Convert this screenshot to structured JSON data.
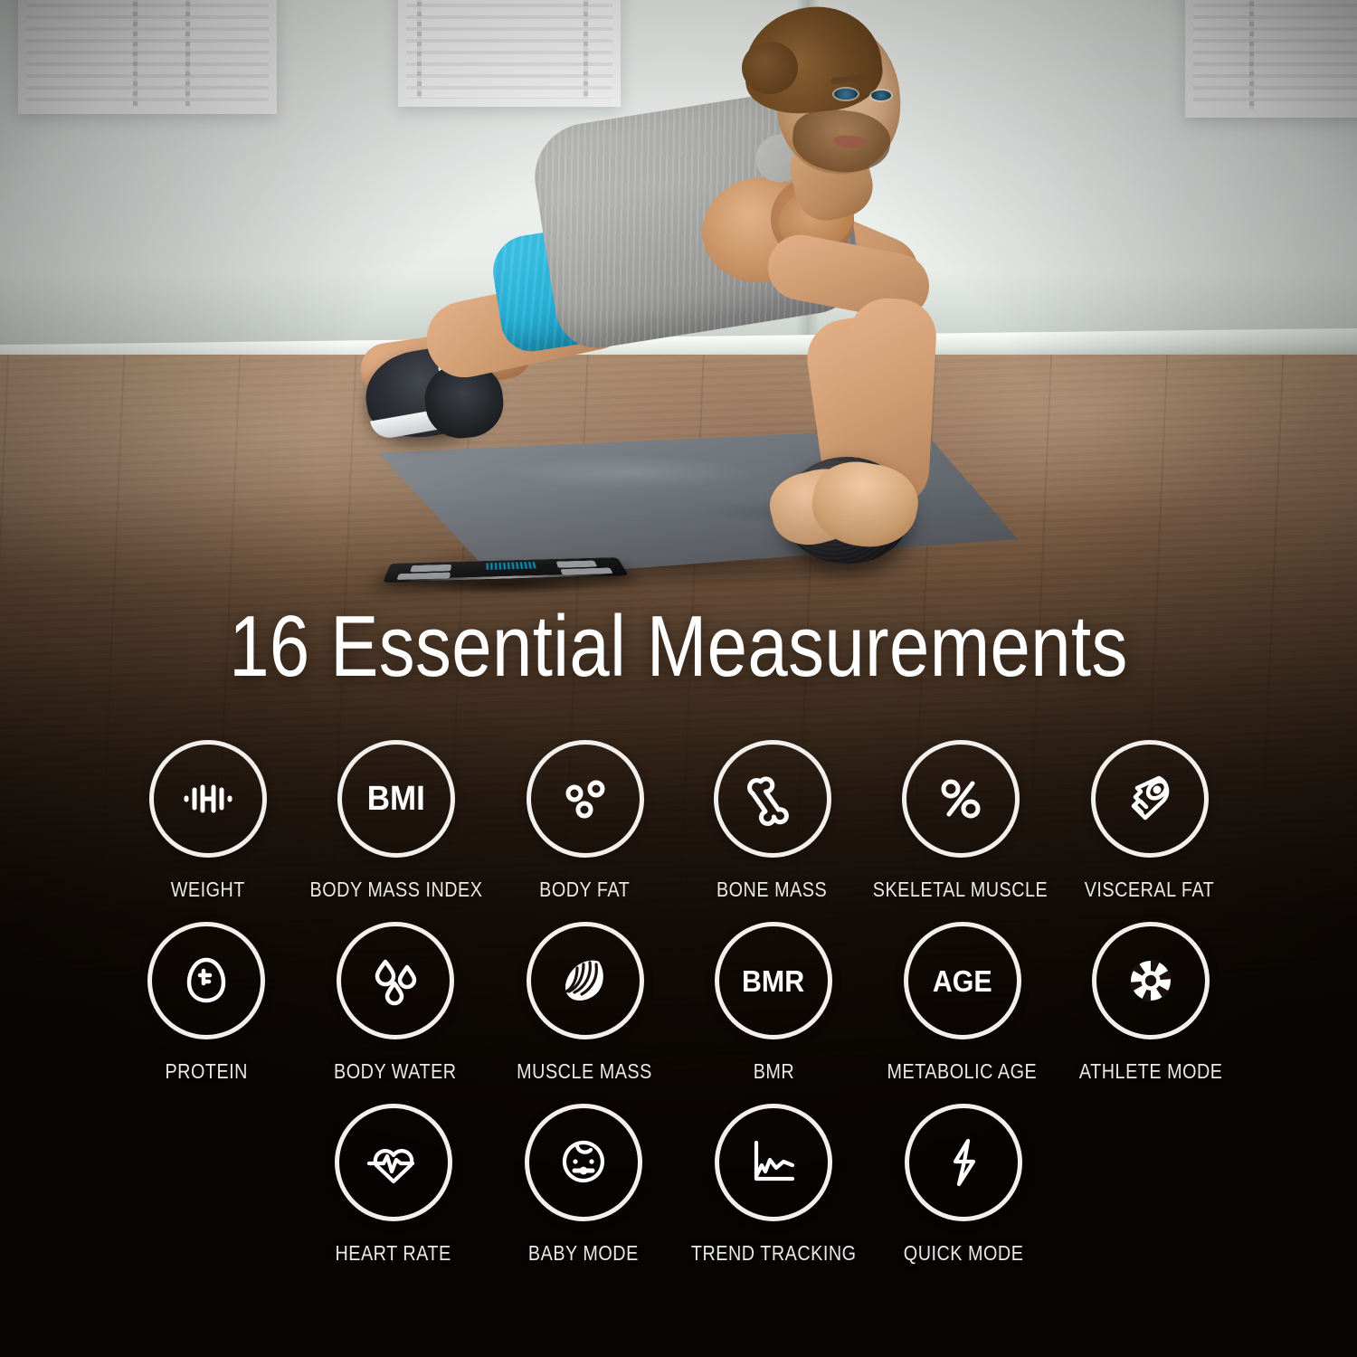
{
  "headline": "16 Essential Measurements",
  "colors": {
    "ring_stroke": "#f2efec",
    "label_text": "#eceae7",
    "headline_text": "#ffffff",
    "backdrop_dark": "#140d08",
    "shorts_cyan": "#29b6dc",
    "tank_gray": "#b4b4b2",
    "scale_display_blue": "#1bb9e6"
  },
  "scene": {
    "subject": "man-doing-plank-pushup",
    "props": [
      "yoga-mat",
      "medicine-ball",
      "smart-body-fat-scale"
    ],
    "setting": "bright-room-wood-floor"
  },
  "rows": [
    {
      "items": [
        {
          "label": "WEIGHT",
          "icon": "dumbbell-icon"
        },
        {
          "label": "BODY MASS INDEX",
          "icon": "bmi-text-icon",
          "icon_text": "BMI"
        },
        {
          "label": "BODY FAT",
          "icon": "fat-cells-icon"
        },
        {
          "label": "BONE MASS",
          "icon": "bone-icon"
        },
        {
          "label": "SKELETAL MUSCLE",
          "icon": "percent-icon"
        },
        {
          "label": "VISCERAL FAT",
          "icon": "tape-measure-icon"
        }
      ]
    },
    {
      "items": [
        {
          "label": "PROTEIN",
          "icon": "egg-icon"
        },
        {
          "label": "BODY WATER",
          "icon": "water-drops-icon"
        },
        {
          "label": "MUSCLE MASS",
          "icon": "muscle-fiber-icon"
        },
        {
          "label": "BMR",
          "icon": "bmr-text-icon",
          "icon_text": "BMR"
        },
        {
          "label": "METABOLIC AGE",
          "icon": "age-text-icon",
          "icon_text": "AGE"
        },
        {
          "label": "ATHLETE MODE",
          "icon": "wheel-rosette-icon"
        }
      ]
    },
    {
      "items": [
        {
          "label": "HEART RATE",
          "icon": "heart-pulse-icon"
        },
        {
          "label": "BABY MODE",
          "icon": "baby-face-icon"
        },
        {
          "label": "TREND TRACKING",
          "icon": "line-chart-icon"
        },
        {
          "label": "QUICK MODE",
          "icon": "lightning-bolt-icon"
        }
      ]
    }
  ]
}
